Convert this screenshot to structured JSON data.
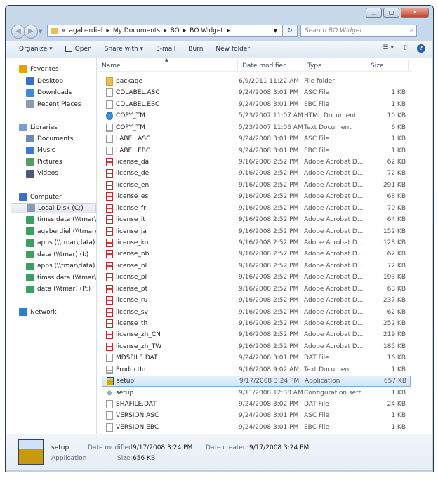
{
  "window": {
    "controls": [
      "minimize",
      "maximize",
      "close"
    ]
  },
  "address": {
    "breadcrumb": [
      "agaberdiel",
      "My Documents",
      "BO",
      "BO Widget"
    ],
    "overflow": "«"
  },
  "search": {
    "placeholder": "Search BO Widget"
  },
  "toolbar": {
    "organize": "Organize ▾",
    "open": "Open",
    "share": "Share with ▾",
    "email": "E-mail",
    "burn": "Burn",
    "new_folder": "New folder"
  },
  "sidebar": {
    "favorites": {
      "label": "Favorites",
      "items": [
        "Desktop",
        "Downloads",
        "Recent Places"
      ]
    },
    "libraries": {
      "label": "Libraries",
      "items": [
        "Documents",
        "Music",
        "Pictures",
        "Videos"
      ]
    },
    "computer": {
      "label": "Computer",
      "items": [
        "Local Disk (C:)",
        "timss data (\\\\tmar\\c",
        "agaberdiel (\\\\tmar\\u",
        "apps (\\\\tmar\\data) (",
        "data (\\\\tmar) (I:)",
        "apps (\\\\tmar\\data) (",
        "timss data (\\\\tmar\\c",
        "data (\\\\tmar) (P:)"
      ],
      "selected": 0
    },
    "network": {
      "label": "Network"
    }
  },
  "columns": [
    "Name",
    "Date modified",
    "Type",
    "Size"
  ],
  "files": [
    [
      "package",
      "6/9/2011 11:22 AM",
      "File folder",
      "",
      "folder"
    ],
    [
      "CDLABEL.ASC",
      "9/24/2008 3:01 PM",
      "ASC File",
      "1 KB",
      "blank"
    ],
    [
      "CDLABEL.EBC",
      "9/24/2008 3:01 PM",
      "EBC File",
      "1 KB",
      "blank"
    ],
    [
      "COPY_TM",
      "5/23/2007 11:07 AM",
      "HTML Document",
      "10 KB",
      "ie"
    ],
    [
      "COPY_TM",
      "5/23/2007 11:06 AM",
      "Text Document",
      "6 KB",
      "text"
    ],
    [
      "LABEL.ASC",
      "9/24/2008 3:01 PM",
      "ASC File",
      "1 KB",
      "blank"
    ],
    [
      "LABEL.EBC",
      "9/24/2008 3:01 PM",
      "EBC File",
      "1 KB",
      "blank"
    ],
    [
      "license_da",
      "9/16/2008 2:52 PM",
      "Adobe Acrobat D...",
      "62 KB",
      "pdf"
    ],
    [
      "license_de",
      "9/16/2008 2:52 PM",
      "Adobe Acrobat D...",
      "72 KB",
      "pdf"
    ],
    [
      "license_en",
      "9/16/2008 2:52 PM",
      "Adobe Acrobat D...",
      "291 KB",
      "pdf"
    ],
    [
      "license_es",
      "9/16/2008 2:52 PM",
      "Adobe Acrobat D...",
      "68 KB",
      "pdf"
    ],
    [
      "license_fr",
      "9/16/2008 2:52 PM",
      "Adobe Acrobat D...",
      "70 KB",
      "pdf"
    ],
    [
      "license_it",
      "9/16/2008 2:52 PM",
      "Adobe Acrobat D...",
      "64 KB",
      "pdf"
    ],
    [
      "license_ja",
      "9/16/2008 2:52 PM",
      "Adobe Acrobat D...",
      "152 KB",
      "pdf"
    ],
    [
      "license_ko",
      "9/16/2008 2:52 PM",
      "Adobe Acrobat D...",
      "128 KB",
      "pdf"
    ],
    [
      "license_nb",
      "9/16/2008 2:52 PM",
      "Adobe Acrobat D...",
      "62 KB",
      "pdf"
    ],
    [
      "license_nl",
      "9/16/2008 2:52 PM",
      "Adobe Acrobat D...",
      "72 KB",
      "pdf"
    ],
    [
      "license_pl",
      "9/16/2008 2:52 PM",
      "Adobe Acrobat D...",
      "193 KB",
      "pdf"
    ],
    [
      "license_pt",
      "9/16/2008 2:52 PM",
      "Adobe Acrobat D...",
      "63 KB",
      "pdf"
    ],
    [
      "license_ru",
      "9/16/2008 2:52 PM",
      "Adobe Acrobat D...",
      "237 KB",
      "pdf"
    ],
    [
      "license_sv",
      "9/16/2008 2:52 PM",
      "Adobe Acrobat D...",
      "62 KB",
      "pdf"
    ],
    [
      "license_th",
      "9/16/2008 2:52 PM",
      "Adobe Acrobat D...",
      "252 KB",
      "pdf"
    ],
    [
      "license_zh_CN",
      "9/16/2008 2:52 PM",
      "Adobe Acrobat D...",
      "219 KB",
      "pdf"
    ],
    [
      "license_zh_TW",
      "9/16/2008 2:52 PM",
      "Adobe Acrobat D...",
      "185 KB",
      "pdf"
    ],
    [
      "MD5FILE.DAT",
      "9/24/2008 3:01 PM",
      "DAT File",
      "16 KB",
      "blank"
    ],
    [
      "ProductId",
      "9/16/2008 9:02 AM",
      "Text Document",
      "1 KB",
      "text"
    ],
    [
      "setup",
      "9/17/2008 3:24 PM",
      "Application",
      "657 KB",
      "app"
    ],
    [
      "setup",
      "9/11/2008 12:38 AM",
      "Configuration sett...",
      "1 KB",
      "config"
    ],
    [
      "SHAFILE.DAT",
      "9/24/2008 3:02 PM",
      "DAT File",
      "24 KB",
      "blank"
    ],
    [
      "VERSION.ASC",
      "9/24/2008 3:01 PM",
      "ASC File",
      "1 KB",
      "blank"
    ],
    [
      "VERSION.EBC",
      "9/24/2008 3:01 PM",
      "EBC File",
      "1 KB",
      "blank"
    ]
  ],
  "selected_index": 26,
  "details": {
    "name": "setup",
    "type": "Application",
    "modified_label": "Date modified:",
    "modified": "9/17/2008 3:24 PM",
    "size_label": "Size:",
    "size": "656 KB",
    "created_label": "Date created:",
    "created": "9/17/2008 3:24 PM"
  }
}
